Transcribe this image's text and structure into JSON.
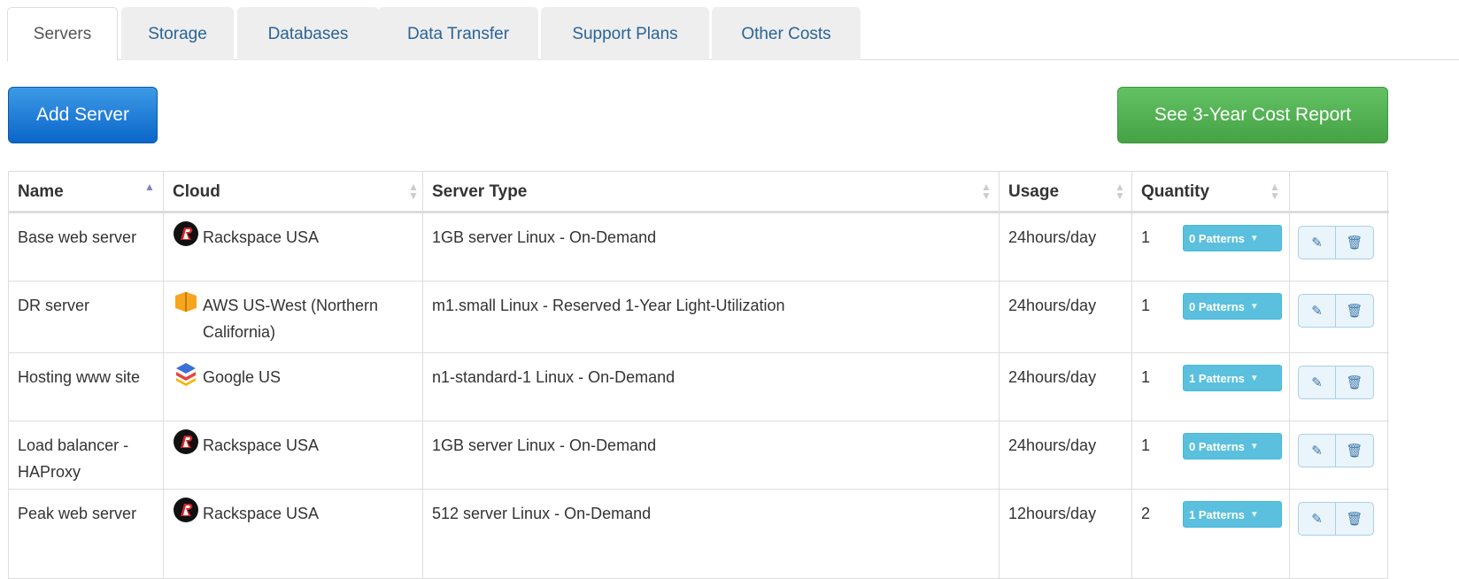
{
  "tabs": [
    {
      "label": "Servers",
      "active": true
    },
    {
      "label": "Storage",
      "active": false
    },
    {
      "label": "Databases",
      "active": false
    },
    {
      "label": "Data Transfer",
      "active": false
    },
    {
      "label": "Support Plans",
      "active": false
    },
    {
      "label": "Other Costs",
      "active": false
    }
  ],
  "toolbar": {
    "add_label": "Add Server",
    "report_label": "See 3-Year Cost Report"
  },
  "table": {
    "columns": [
      "Name",
      "Cloud",
      "Server Type",
      "Usage",
      "Quantity"
    ],
    "sorted_column": "Name",
    "rows": [
      {
        "name": "Base web server",
        "cloud": "Rackspace USA",
        "cloud_icon": "rackspace-icon",
        "server_type": "1GB server Linux - On-Demand",
        "usage": "24hours/day",
        "quantity": "1",
        "patterns": "0 Patterns"
      },
      {
        "name": "DR server",
        "cloud": "AWS US-West (Northern California)",
        "cloud_icon": "aws-icon",
        "server_type": "m1.small Linux - Reserved 1-Year Light-Utilization",
        "usage": "24hours/day",
        "quantity": "1",
        "patterns": "0 Patterns"
      },
      {
        "name": "Hosting www site",
        "cloud": "Google US",
        "cloud_icon": "google-cloud-icon",
        "server_type": "n1-standard-1 Linux - On-Demand",
        "usage": "24hours/day",
        "quantity": "1",
        "patterns": "1 Patterns"
      },
      {
        "name": "Load balancer - HAProxy",
        "cloud": "Rackspace USA",
        "cloud_icon": "rackspace-icon",
        "server_type": "1GB server Linux - On-Demand",
        "usage": "24hours/day",
        "quantity": "1",
        "patterns": "0 Patterns"
      },
      {
        "name": "Peak web server",
        "cloud": "Rackspace USA",
        "cloud_icon": "rackspace-icon",
        "server_type": "512 server Linux - On-Demand",
        "usage": "12hours/day",
        "quantity": "2",
        "patterns": "1 Patterns"
      }
    ]
  },
  "icons": {
    "edit": "pencil-icon",
    "delete": "trash-icon"
  },
  "colors": {
    "primary": "#0a66c9",
    "success": "#45a245",
    "info": "#5bc0de",
    "link": "#2a6496"
  }
}
